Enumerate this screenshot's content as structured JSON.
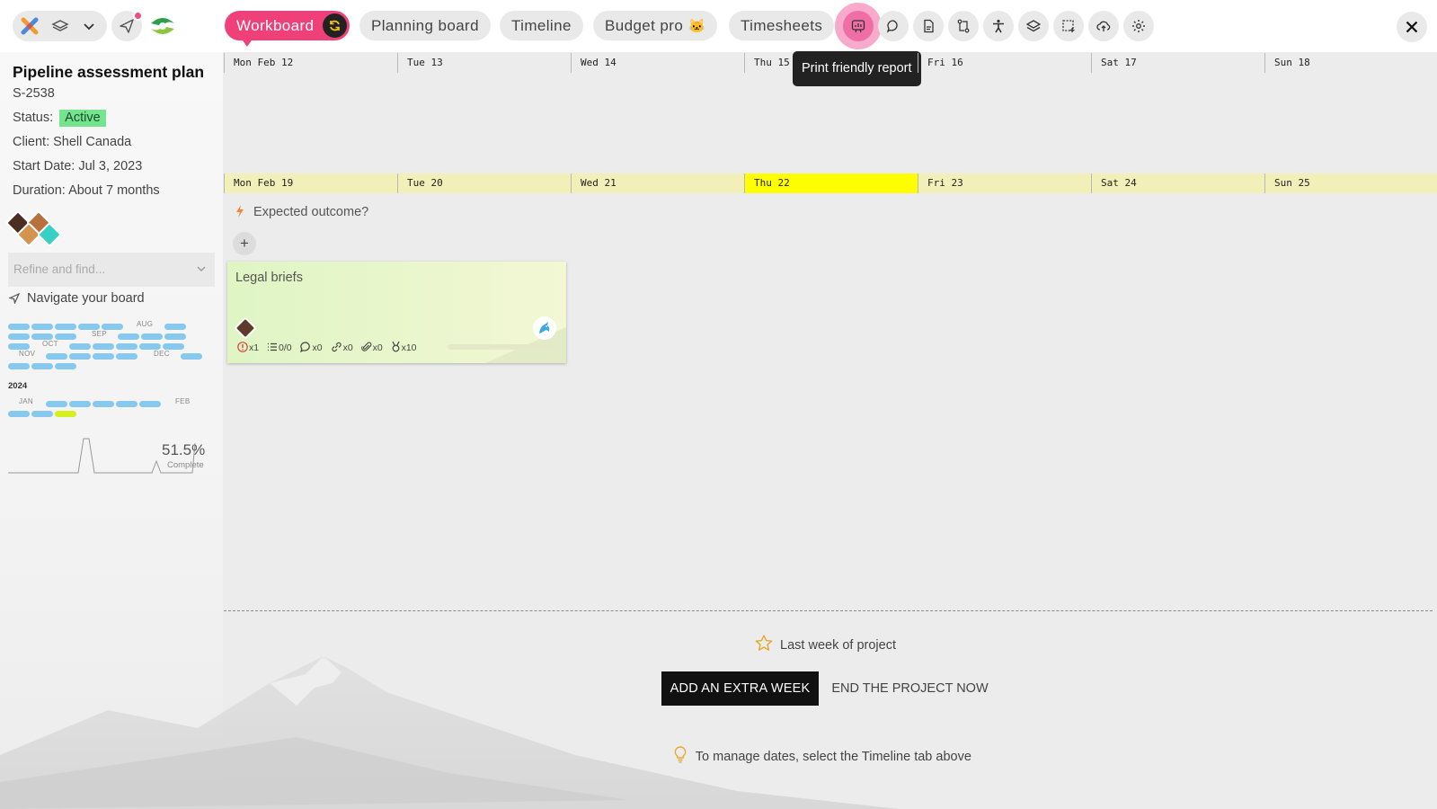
{
  "tabs": [
    {
      "label": "Workboard",
      "active": true
    },
    {
      "label": "Planning board"
    },
    {
      "label": "Timeline"
    },
    {
      "label": "Budget pro",
      "emoji": "🐱"
    },
    {
      "label": "Timesheets"
    }
  ],
  "toolbar": {
    "icons": [
      "report-icon",
      "chat-icon",
      "document-icon",
      "transfer-icon",
      "accessibility-icon",
      "layers-icon",
      "selection-icon",
      "cloud-sync-icon",
      "settings-icon",
      "close-icon"
    ],
    "highlighted": "report-icon",
    "tooltip": "Print friendly report"
  },
  "project": {
    "title": "Pipeline assessment plan",
    "code": "S-2538",
    "status_label": "Status:",
    "status_value": "Active",
    "client": "Client: Shell Canada",
    "start": "Start Date: Jul 3, 2023",
    "duration": "Duration: About 7 months"
  },
  "sidebar": {
    "refine_placeholder": "Refine and find...",
    "navigate_label": "Navigate your board",
    "mini_calendar": {
      "months_2023": [
        "AUG",
        "SEP",
        "OCT",
        "NOV",
        "DEC"
      ],
      "year_2024": "2024",
      "months_2024": [
        "JAN",
        "FEB"
      ]
    },
    "progress_percent": "51.5%",
    "progress_label": "Complete"
  },
  "weeks": [
    {
      "days": [
        "Mon Feb 12",
        "Tue 13",
        "Wed 14",
        "Thu 15",
        "Fri 16",
        "Sat 17",
        "Sun 18"
      ]
    },
    {
      "days": [
        "Mon Feb 19",
        "Tue 20",
        "Wed 21",
        "Thu 22",
        "Fri 23",
        "Sat 24",
        "Sun 25"
      ],
      "today_index": 3
    }
  ],
  "board": {
    "outcome_prompt": "Expected outcome?",
    "add_label": "+",
    "card": {
      "title": "Legal briefs",
      "stats": {
        "alerts": "x1",
        "checklist": "0/0",
        "comments": "x0",
        "links": "x0",
        "attachments": "x0",
        "awards": "x10"
      }
    }
  },
  "footer": {
    "last_week": "Last week of project",
    "add_week": "ADD AN EXTRA WEEK",
    "end_project": "END THE PROJECT NOW",
    "hint": "To manage dates, select the Timeline tab above"
  },
  "colors": {
    "accent": "#f0407a",
    "today": "#ffff00",
    "status_active": "#74e48f",
    "calendar_pill": "#86c8ee",
    "current_pill": "#d7ef1c"
  }
}
